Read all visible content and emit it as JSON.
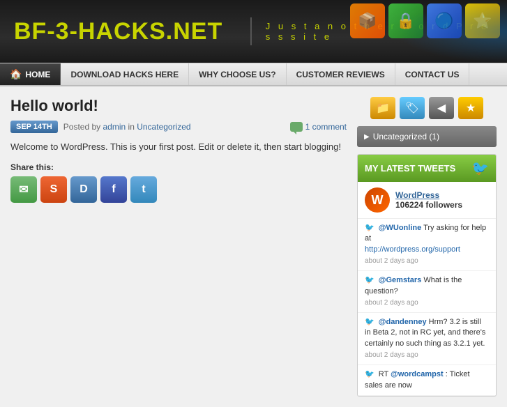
{
  "header": {
    "site_title_prefix": "BF-",
    "site_title_number": "3",
    "site_title_suffix": "-HACKS.NET",
    "tagline": "J u s t   a n o t h e r   W o r d P r e s s   s i t e"
  },
  "nav": {
    "items": [
      {
        "id": "home",
        "label": "HOME",
        "icon": "🏠"
      },
      {
        "id": "download",
        "label": "DOWNLOAD HACKS HERE"
      },
      {
        "id": "why",
        "label": "WHY CHOOSE US?"
      },
      {
        "id": "reviews",
        "label": "CUSTOMER REVIEWS"
      },
      {
        "id": "contact",
        "label": "CONTACT US"
      }
    ]
  },
  "post": {
    "title": "Hello world!",
    "date": "SEP 14TH",
    "meta_prefix": "Posted by",
    "author": "admin",
    "meta_middle": "in",
    "category": "Uncategorized",
    "comment_count": "1 comment",
    "body": "Welcome to WordPress. This is your first post. Edit or delete it, then start blogging!",
    "share_label": "Share this:",
    "share_buttons": [
      {
        "id": "email",
        "label": "✉"
      },
      {
        "id": "stumbleupon",
        "label": "S"
      },
      {
        "id": "digg",
        "label": "D"
      },
      {
        "id": "facebook",
        "label": "f"
      },
      {
        "id": "twitter",
        "label": "t"
      }
    ]
  },
  "sidebar": {
    "icon_buttons": [
      {
        "id": "folder",
        "icon": "📁"
      },
      {
        "id": "tag",
        "icon": "🏷"
      },
      {
        "id": "prev",
        "icon": "◀"
      },
      {
        "id": "star",
        "icon": "★"
      }
    ],
    "category_label": "Uncategorized (1)",
    "tweets_header": "MY LATEST TWEETS",
    "wp_name": "WordPress",
    "wp_followers": "106224 followers",
    "tweets": [
      {
        "user": "@WUonline",
        "text": " Try asking for help at",
        "link": "http://wordpress.org/support",
        "time": "about 2 days ago"
      },
      {
        "user": "@Gemstars",
        "text": " What is the question?",
        "link": "",
        "time": "about 2 days ago"
      },
      {
        "user": "@dandenney",
        "text": " Hrm? 3.2 is still in Beta 2, not in RC yet, and there's certainly no such thing as 3.2.1 yet.",
        "link": "",
        "time": "about 2 days ago"
      },
      {
        "user": "@wordcampst",
        "text_prefix": "RT ",
        "text": ": Ticket sales are now",
        "link": "",
        "time": ""
      }
    ]
  }
}
